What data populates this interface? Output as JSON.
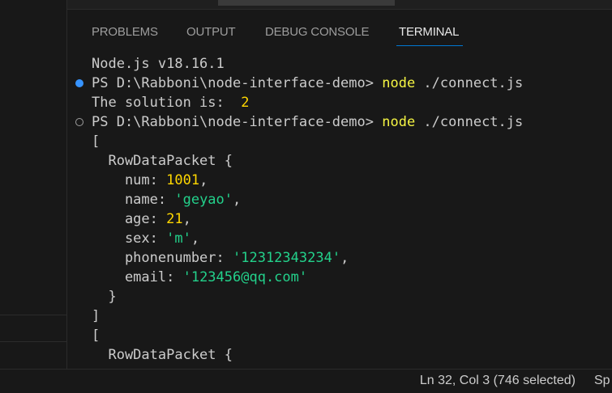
{
  "panel": {
    "tabs": [
      {
        "label": "PROBLEMS",
        "active": false
      },
      {
        "label": "OUTPUT",
        "active": false
      },
      {
        "label": "DEBUG CONSOLE",
        "active": false
      },
      {
        "label": "TERMINAL",
        "active": true
      }
    ]
  },
  "terminal": {
    "version_line": "Node.js v18.16.1",
    "prompt1": {
      "marker": "success",
      "prompt": "PS D:\\Rabboni\\node-interface-demo> ",
      "command": "node",
      "args": " ./connect.js"
    },
    "solution_line": {
      "label": "The solution is:  ",
      "value": "2"
    },
    "prompt2": {
      "marker": "neutral",
      "prompt": "PS D:\\Rabboni\\node-interface-demo> ",
      "command": "node",
      "args": " ./connect.js"
    },
    "open_bracket": "[",
    "packet_header": "  RowDataPacket {",
    "fields": {
      "num": {
        "key": "    num: ",
        "value": "1001",
        "end": ","
      },
      "name": {
        "key": "    name: ",
        "value": "'geyao'",
        "end": ","
      },
      "age": {
        "key": "    age: ",
        "value": "21",
        "end": ","
      },
      "sex": {
        "key": "    sex: ",
        "value": "'m'",
        "end": ","
      },
      "phonenumber": {
        "key": "    phonenumber: ",
        "value": "'12312343234'",
        "end": ","
      },
      "email": {
        "key": "    email: ",
        "value": "'123456@qq.com'",
        "end": ""
      }
    },
    "packet_close": "  }",
    "close_bracket": "]",
    "open_bracket2": "[",
    "packet_header2": "  RowDataPacket {"
  },
  "statusbar": {
    "position": "Ln 32, Col 3 (746 selected)",
    "spaces": "Sp"
  },
  "colors": {
    "background": "#181818",
    "accent": "#0078d4",
    "number": "#ffd700",
    "string": "#23d18b",
    "command": "#f5f543"
  }
}
